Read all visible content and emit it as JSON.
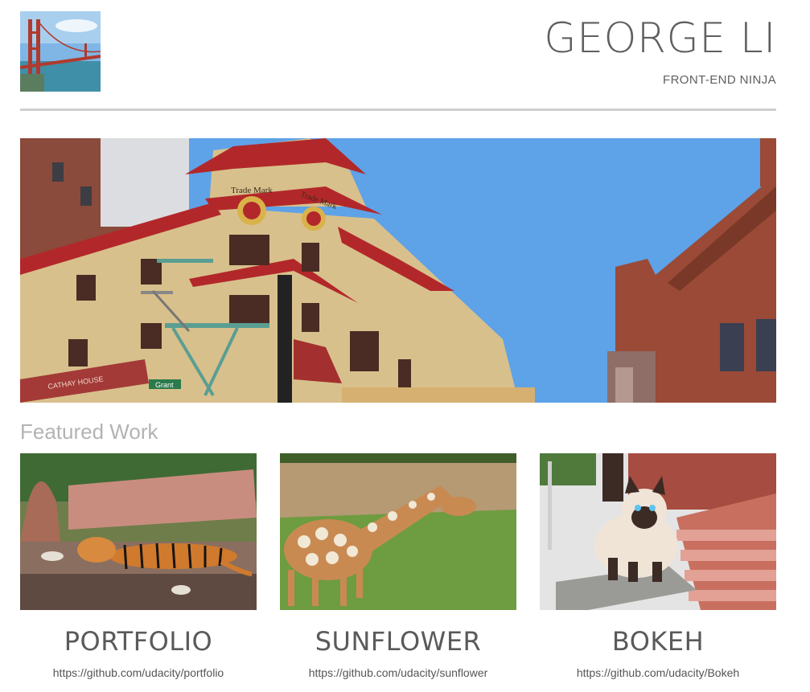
{
  "header": {
    "name": "GEORGE LI",
    "tagline": "FRONT-END NINJA",
    "logo_icon": "golden-gate-bridge-photo"
  },
  "hero": {
    "image": "chinatown-building-photo",
    "sign_text_1": "Trade Mark",
    "sign_text_2": "Trade Mark",
    "store_sign": "CATHAY HOUSE",
    "street_sign": "Grant"
  },
  "featured": {
    "title": "Featured Work",
    "projects": [
      {
        "title": "PORTFOLIO",
        "link": "https://github.com/udacity/portfolio",
        "image": "tiger-photo"
      },
      {
        "title": "SUNFLOWER",
        "link": "https://github.com/udacity/sunflower",
        "image": "giraffe-photo"
      },
      {
        "title": "BOKEH",
        "link": "https://github.com/udacity/Bokeh",
        "image": "cat-photo"
      }
    ]
  },
  "colors": {
    "text": "#5f5f5f",
    "muted": "#b3b3b3",
    "rule": "#cfcfcf",
    "sky": "#5ea2e8"
  }
}
